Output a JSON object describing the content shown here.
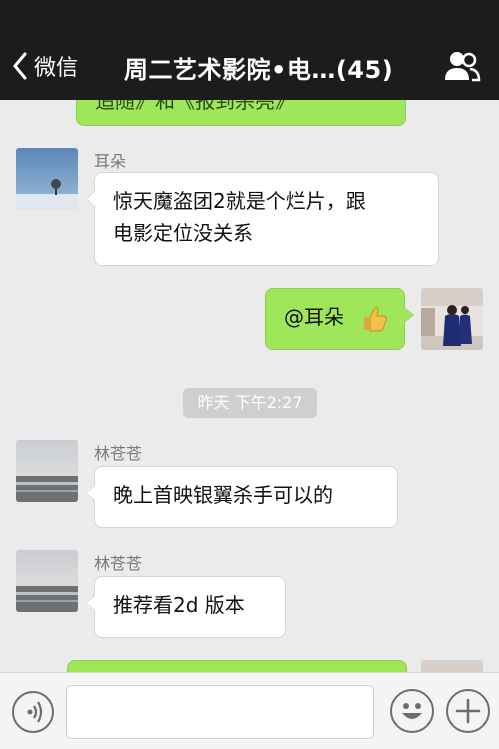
{
  "header": {
    "back_label": "微信",
    "title": "周二艺术影院•电…(45)"
  },
  "messages": {
    "top_partial": "追随》和《报到杀亮》",
    "m1": {
      "sender": "耳朵",
      "text_line1": "惊天魔盗团2就是个烂片，跟",
      "text_line2": "电影定位没关系"
    },
    "m2": {
      "text": "@耳朵"
    },
    "timestamp": "昨天 下午2:27",
    "m3": {
      "sender": "林苍苍",
      "text": "晚上首映银翼杀手可以的"
    },
    "m4": {
      "sender": "林苍苍",
      "text": "推荐看2d 版本"
    }
  },
  "icons": {
    "back": "chevron-left-icon",
    "members": "people-icon",
    "voice": "voice-icon",
    "emoji": "emoji-icon",
    "plus": "plus-icon",
    "thumbs": "thumbs-up-icon"
  },
  "colors": {
    "header_bg": "#1c1c1c",
    "chat_bg": "#ebebeb",
    "bubble_green": "#9fe65a",
    "bubble_white": "#ffffff"
  }
}
